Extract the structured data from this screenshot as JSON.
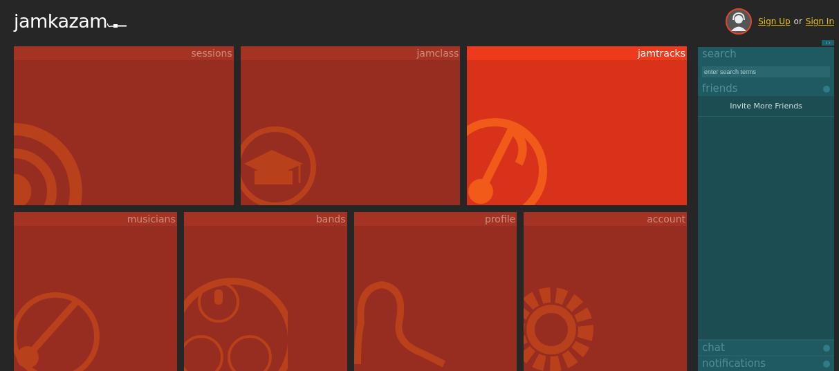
{
  "header": {
    "logo": "jamkazam",
    "auth": {
      "sign_up": "Sign Up",
      "separator": "or",
      "sign_in": "Sign In"
    }
  },
  "tile_rows": [
    [
      {
        "label": "sessions",
        "kind": "sessions",
        "selected": false
      },
      {
        "label": "jamclass",
        "kind": "jamclass",
        "selected": false
      },
      {
        "label": "jamtracks",
        "kind": "jamtracks",
        "selected": true
      }
    ],
    [
      {
        "label": "musicians",
        "kind": "musicians",
        "selected": false
      },
      {
        "label": "bands",
        "kind": "bands",
        "selected": false
      },
      {
        "label": "profile",
        "kind": "profile",
        "selected": false
      },
      {
        "label": "account",
        "kind": "account",
        "selected": false
      }
    ]
  ],
  "sidebar": {
    "search": {
      "title": "search",
      "placeholder": "enter search terms"
    },
    "friends": {
      "title": "friends",
      "invite": "Invite More Friends"
    },
    "bottom_panels": [
      {
        "title": "chat"
      },
      {
        "title": "notifications"
      }
    ]
  }
}
